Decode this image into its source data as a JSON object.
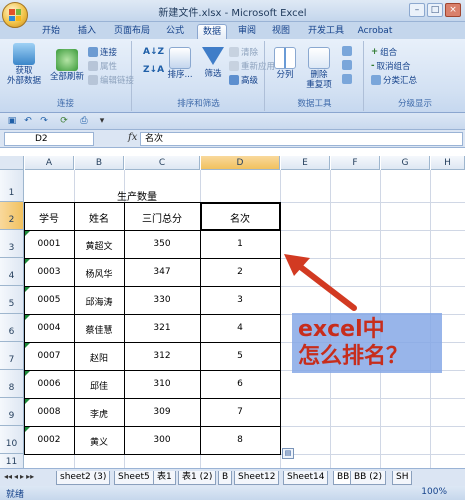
{
  "window": {
    "title": "新建文件.xlsx - Microsoft Excel"
  },
  "tabs": [
    "开始",
    "插入",
    "页面布局",
    "公式",
    "数据",
    "审阅",
    "视图",
    "开发工具",
    "Acrobat"
  ],
  "active_tab": "数据",
  "ribbon": {
    "get_external": "获取\n外部数据",
    "refresh_all": "全部刷新",
    "connections": "连接",
    "properties": "属性",
    "edit_links": "编辑链接",
    "group_connect": "连接",
    "sort": "排序...",
    "filter": "筛选",
    "clear": "清除",
    "reapply": "重新应用",
    "advanced": "高级",
    "group_sort": "排序和筛选",
    "text_to_cols": "分列",
    "remove_dup": "删除\n重复项",
    "group_data": "数据工具",
    "group_btn": "组合",
    "ungroup_btn": "取消组合",
    "subtotal": "分类汇总",
    "group_outline": "分级显示"
  },
  "formula_bar": {
    "name_box": "D2",
    "fx": "fx",
    "formula": "名次"
  },
  "columns": [
    "A",
    "B",
    "C",
    "D",
    "E",
    "F",
    "G",
    "H"
  ],
  "rows": [
    "1",
    "2",
    "3",
    "4",
    "5",
    "6",
    "7",
    "8",
    "9",
    "10",
    "11"
  ],
  "sheet": {
    "title": "生产数量",
    "headers": [
      "学号",
      "姓名",
      "三门总分",
      "名次"
    ],
    "data": [
      [
        "0001",
        "黄超文",
        "350",
        "1"
      ],
      [
        "0003",
        "杨风华",
        "347",
        "2"
      ],
      [
        "0005",
        "邱海涛",
        "330",
        "3"
      ],
      [
        "0004",
        "蔡佳慧",
        "321",
        "4"
      ],
      [
        "0007",
        "赵阳",
        "312",
        "5"
      ],
      [
        "0006",
        "邱佳",
        "310",
        "6"
      ],
      [
        "0008",
        "李虎",
        "309",
        "7"
      ],
      [
        "0002",
        "黄义",
        "300",
        "8"
      ]
    ]
  },
  "overlay": {
    "line1": "excel中",
    "line2": "怎么排名？"
  },
  "sheet_tabs": [
    "sheet2 (3)",
    "Sheet5",
    "表1",
    "表1 (2)",
    "B",
    "Sheet12",
    "Sheet14",
    "BB",
    "BB (2)",
    "SH"
  ],
  "status": {
    "ready": "就绪",
    "zoom": "100%"
  }
}
